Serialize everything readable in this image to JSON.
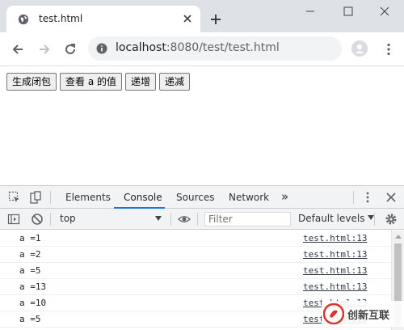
{
  "browser": {
    "tab_title": "test.html",
    "url_host": "localhost",
    "url_path": ":8080/test/test.html"
  },
  "page": {
    "buttons": [
      {
        "label": "生成闭包"
      },
      {
        "label": "查看 a 的值"
      },
      {
        "label": "递增"
      },
      {
        "label": "递减"
      }
    ]
  },
  "devtools": {
    "tabs": [
      {
        "label": "Elements"
      },
      {
        "label": "Console"
      },
      {
        "label": "Sources"
      },
      {
        "label": "Network"
      }
    ],
    "active_tab": "Console",
    "more_tabs": "»",
    "context": "top",
    "filter_placeholder": "Filter",
    "levels_label": "Default levels",
    "console_rows": [
      {
        "message": "a =1",
        "source": "test.html:13"
      },
      {
        "message": "a =2",
        "source": "test.html:13"
      },
      {
        "message": "a =5",
        "source": "test.html:13"
      },
      {
        "message": "a =13",
        "source": "test.html:13"
      },
      {
        "message": "a =10",
        "source": "test.html:13"
      },
      {
        "message": "a =5",
        "source": "test.html:13"
      }
    ]
  },
  "watermark": {
    "text": "创新互联"
  },
  "colors": {
    "tabstrip_bg": "#dee1e6",
    "omnibox_bg": "#f1f3f4",
    "devtools_accent": "#1a73e8",
    "watermark_accent": "#d9332b"
  },
  "icons": [
    "globe-icon",
    "close-icon",
    "plus-icon",
    "minimize-icon",
    "maximize-icon",
    "window-close-icon",
    "back-arrow-icon",
    "forward-arrow-icon",
    "reload-icon",
    "info-icon",
    "profile-icon",
    "more-vert-icon",
    "inspect-element-icon",
    "device-toolbar-icon",
    "sidebar-toggle-icon",
    "clear-console-icon",
    "eye-icon",
    "gear-icon"
  ]
}
